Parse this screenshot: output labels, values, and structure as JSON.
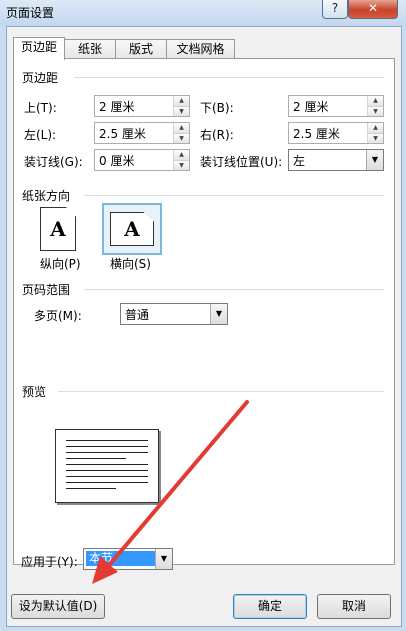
{
  "window": {
    "title": "页面设置",
    "help_label": "?",
    "close_label": "✕"
  },
  "tabs": [
    "页边距",
    "纸张",
    "版式",
    "文档网格"
  ],
  "margins": {
    "section_label": "页边距",
    "top": {
      "label": "上(T):",
      "value": "2 厘米"
    },
    "bottom": {
      "label": "下(B):",
      "value": "2 厘米"
    },
    "left": {
      "label": "左(L):",
      "value": "2.5 厘米"
    },
    "right": {
      "label": "右(R):",
      "value": "2.5 厘米"
    },
    "gutter": {
      "label": "装订线(G):",
      "value": "0 厘米"
    },
    "gutter_position": {
      "label": "装订线位置(U):",
      "value": "左"
    }
  },
  "orientation": {
    "section_label": "纸张方向",
    "portrait_label": "纵向(P)",
    "landscape_label": "横向(S)",
    "glyph": "A",
    "selected": "landscape"
  },
  "pages": {
    "section_label": "页码范围",
    "multiple_label": "多页(M):",
    "multiple_value": "普通"
  },
  "preview": {
    "section_label": "预览"
  },
  "apply_to": {
    "label": "应用于(Y):",
    "value": "本节"
  },
  "buttons": {
    "set_default": "设为默认值(D)",
    "ok": "确定",
    "cancel": "取消"
  },
  "colors": {
    "annotation_arrow": "#e33b32",
    "selection": "#3399ff"
  }
}
